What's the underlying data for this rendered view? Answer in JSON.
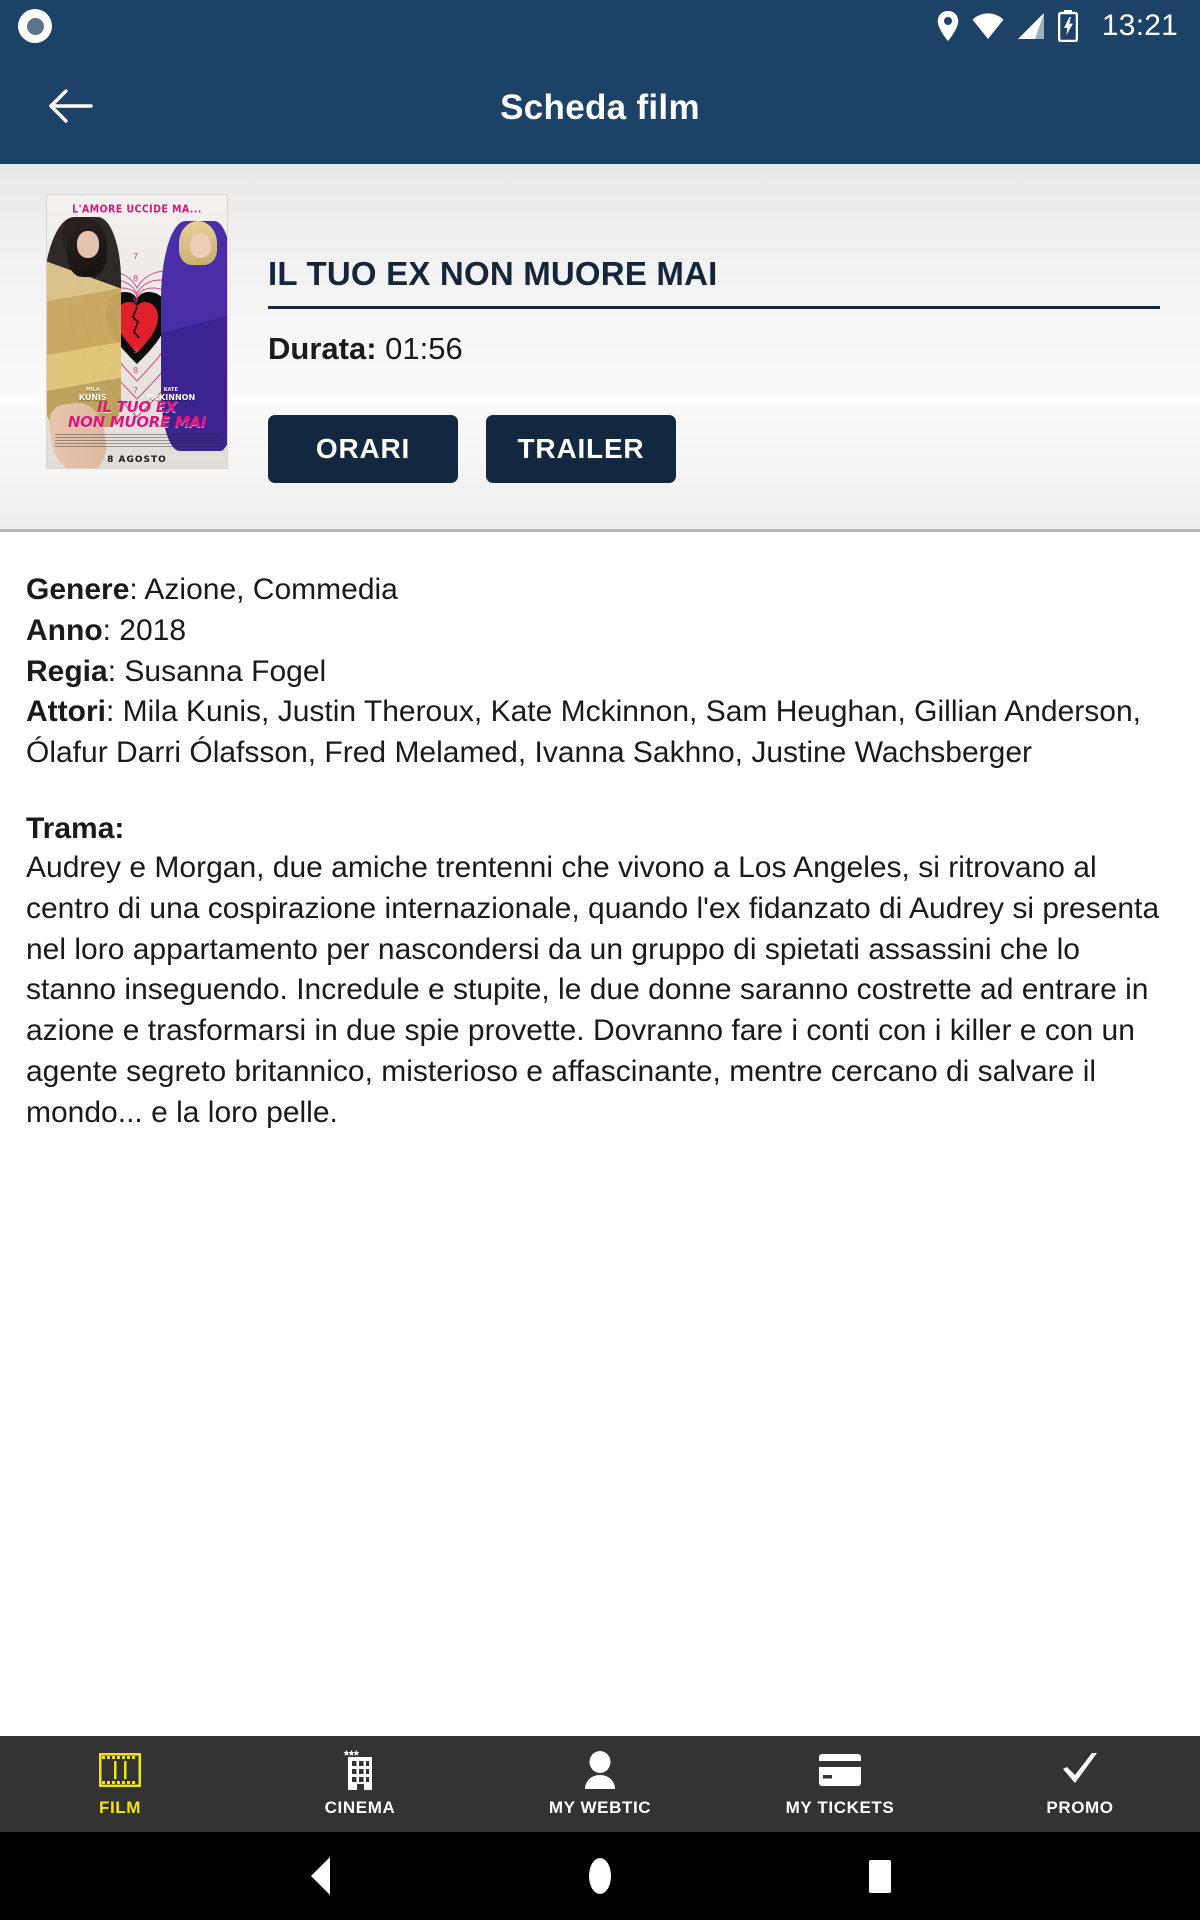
{
  "status_bar": {
    "time": "13:21",
    "icons": [
      "location-icon",
      "wifi-icon",
      "signal-icon",
      "battery-charging-icon"
    ],
    "background": "#1d4268"
  },
  "app_bar": {
    "title": "Scheda film",
    "back_icon": "arrow-left-icon",
    "background": "#1d4268"
  },
  "hero": {
    "poster": {
      "alt": "IL TUO EX NON MUORE MAI",
      "tagline": "L'AMORE UCCIDE MA...",
      "actor_left_first": "MILA",
      "actor_left_last": "KUNIS",
      "actor_right_first": "KATE",
      "actor_right_last": "McKINNON",
      "title_line1": "IL TUO EX",
      "title_line2": "NON MUORE MAI",
      "release_date": "8 AGOSTO"
    },
    "film_title": "IL TUO EX NON MUORE MAI",
    "duration_label": "Durata:",
    "duration_value": "01:56",
    "buttons": {
      "orari": "ORARI",
      "trailer": "TRAILER"
    },
    "button_color": "#122740"
  },
  "details": {
    "genere_label": "Genere",
    "genere_value": ": Azione, Commedia",
    "anno_label": "Anno",
    "anno_value": ": 2018",
    "regia_label": "Regia",
    "regia_value": ": Susanna Fogel",
    "attori_label": "Attori",
    "attori_value": ": Mila Kunis, Justin Theroux, Kate Mckinnon, Sam Heughan, Gillian Anderson, Ólafur Darri Ólafsson, Fred Melamed, Ivanna Sakhno, Justine Wachsberger",
    "trama_label": "Trama:",
    "trama_value": "Audrey e Morgan, due amiche trentenni che vivono a Los Angeles, si ritrovano al centro di una cospirazione internazionale, quando l'ex fidanzato di Audrey si presenta nel loro appartamento per nascondersi da un gruppo di spietati assassini che lo stanno inseguendo. Incredule e stupite, le due donne saranno costrette ad entrare in azione e trasformarsi in due spie provette. Dovranno fare i conti con i killer e con un agente segreto britannico, misterioso e affascinante, mentre cercano di salvare il mondo... e la loro pelle."
  },
  "tab_bar": {
    "active_color": "#f2e50b",
    "background": "#333333",
    "items": [
      {
        "label": "FILM",
        "icon": "film-strip-icon",
        "active": true
      },
      {
        "label": "CINEMA",
        "icon": "building-icon",
        "active": false
      },
      {
        "label": "MY WEBTIC",
        "icon": "person-icon",
        "active": false
      },
      {
        "label": "MY TICKETS",
        "icon": "card-icon",
        "active": false
      },
      {
        "label": "PROMO",
        "icon": "checkmark-icon",
        "active": false
      }
    ]
  },
  "nav_bar": {
    "buttons": [
      "back-triangle-icon",
      "home-circle-icon",
      "recents-square-icon"
    ],
    "background": "#000000"
  }
}
